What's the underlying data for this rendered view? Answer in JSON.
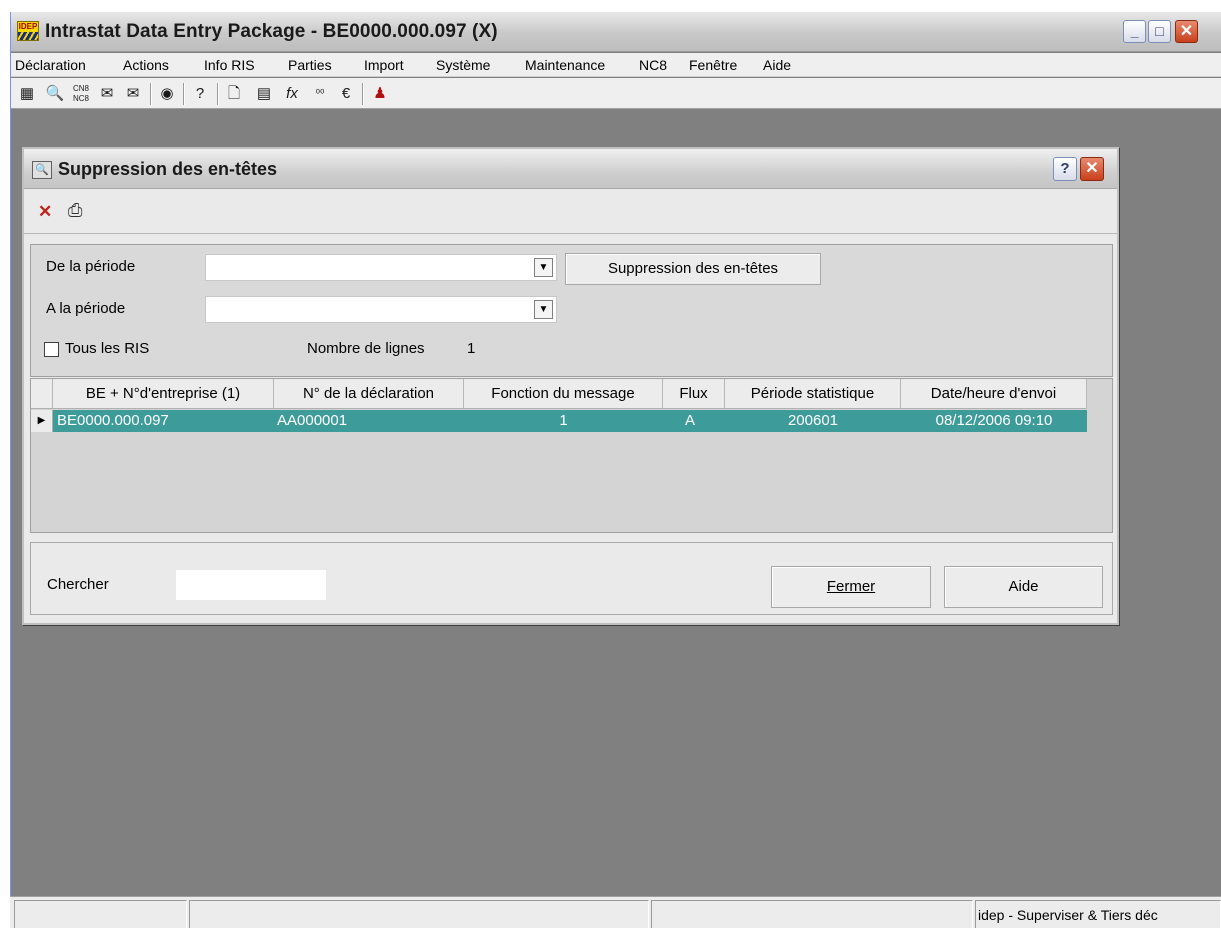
{
  "window": {
    "icon_label": "IDEP",
    "title": "Intrastat Data Entry Package - BE0000.000.097 (X)",
    "min_glyph": "_",
    "max_glyph": "□",
    "close_glyph": "✕"
  },
  "menu": [
    "Déclaration",
    "Actions",
    "Info RIS",
    "Parties",
    "Import",
    "Système",
    "Maintenance",
    "NC8",
    "Fenêtre",
    "Aide"
  ],
  "toolbar": {
    "icons": [
      "grid-icon",
      "binoculars-icon",
      "cn8-nc8-icon",
      "envelope-import-icon",
      "envelope-export-icon",
      "camera-icon",
      "help-book-icon",
      "new-document-icon",
      "calculator-icon",
      "function-icon",
      "decimals-icon",
      "euro-icon",
      "users-icon"
    ],
    "cn8_label": "CN8",
    "nc8_label": "NC8"
  },
  "dialog": {
    "title": "Suppression des en-têtes",
    "help_glyph": "?",
    "close_glyph": "✕",
    "from_label": "De la période",
    "to_label": "A la période",
    "from_value": "",
    "to_value": "",
    "delete_button": "Suppression des en-têtes",
    "all_ris_label": "Tous les RIS",
    "all_ris_checked": false,
    "line_count_label": "Nombre de lignes",
    "line_count": "1",
    "columns": [
      "BE + N°d'entreprise (1)",
      "N° de la déclaration",
      "Fonction du message",
      "Flux",
      "Période statistique",
      "Date/heure d'envoi"
    ],
    "rows": [
      {
        "company": "BE0000.000.097",
        "declaration": "AA000001",
        "function": "1",
        "flux": "A",
        "period": "200601",
        "sent": "08/12/2006 09:10"
      }
    ],
    "search_label": "Chercher",
    "search_value": "",
    "close_button": "Fermer",
    "help_button": "Aide",
    "selected_row_color": "#3d9b99"
  },
  "statusbar": {
    "text": "idep - Superviser & Tiers déc"
  }
}
